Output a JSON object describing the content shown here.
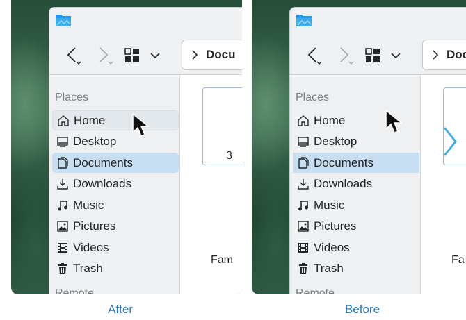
{
  "captions": {
    "left": "After",
    "right": "Before"
  },
  "location": {
    "text": "Docu"
  },
  "sidebar": {
    "places_heading": "Places",
    "remote_heading": "Remote",
    "items": [
      {
        "label": "Home",
        "icon": "home-icon"
      },
      {
        "label": "Desktop",
        "icon": "desktop-icon"
      },
      {
        "label": "Documents",
        "icon": "documents-icon"
      },
      {
        "label": "Downloads",
        "icon": "downloads-icon"
      },
      {
        "label": "Music",
        "icon": "music-icon"
      },
      {
        "label": "Pictures",
        "icon": "pictures-icon"
      },
      {
        "label": "Videos",
        "icon": "videos-icon"
      },
      {
        "label": "Trash",
        "icon": "trash-icon"
      }
    ]
  },
  "after_content": {
    "tile_label": "3",
    "bottom_label": "Fam"
  },
  "before_content": {
    "bottom_label": "Fa"
  },
  "colors": {
    "accent": "#3daee9",
    "selected": "#c8dff2",
    "hover": "#e3e8ed",
    "caption": "#2b7bb9"
  }
}
